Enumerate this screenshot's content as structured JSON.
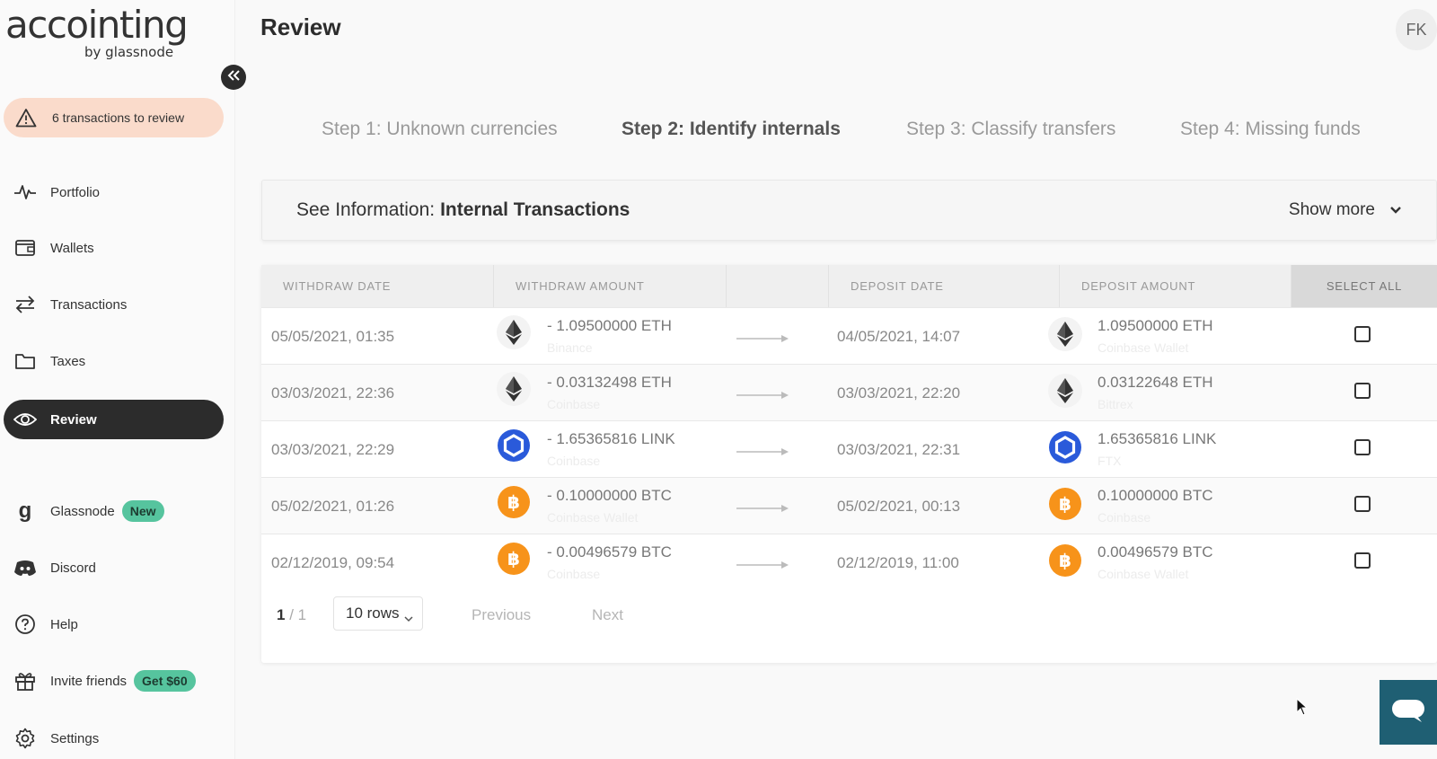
{
  "app": {
    "logo_text": "accointing",
    "logo_sub": "by glassnode",
    "user_initials": "FK"
  },
  "alert": {
    "label": "6 transactions to review",
    "icon": "warning-icon"
  },
  "sidebar": {
    "items": [
      {
        "label": "Portfolio",
        "icon": "pulse-icon"
      },
      {
        "label": "Wallets",
        "icon": "wallet-icon"
      },
      {
        "label": "Transactions",
        "icon": "swap-arrows-icon"
      },
      {
        "label": "Taxes",
        "icon": "folder-icon"
      },
      {
        "label": "Review",
        "icon": "eye-icon",
        "active": true
      },
      {
        "label": "Glassnode",
        "icon": "glassnode-g-icon",
        "badge": "New"
      },
      {
        "label": "Discord",
        "icon": "discord-icon"
      },
      {
        "label": "Help",
        "icon": "help-circle-icon"
      },
      {
        "label": "Invite friends",
        "icon": "gift-icon",
        "badge": "Get $60"
      },
      {
        "label": "Settings",
        "icon": "gear-icon"
      }
    ]
  },
  "header": {
    "title": "Review"
  },
  "steps": [
    {
      "label": "Step 1: Unknown currencies",
      "active": false
    },
    {
      "label": "Step 2: Identify internals",
      "active": true
    },
    {
      "label": "Step 3: Classify transfers",
      "active": false
    },
    {
      "label": "Step 4: Missing funds",
      "active": false
    }
  ],
  "info_bar": {
    "prefix": "See Information:",
    "title": "Internal Transactions",
    "show_more": "Show more"
  },
  "table": {
    "columns": [
      "WITHDRAW DATE",
      "WITHDRAW AMOUNT",
      "DEPOSIT DATE",
      "DEPOSIT AMOUNT",
      "SELECT ALL"
    ],
    "rows": [
      {
        "withdraw_date": "05/05/2021, 01:35",
        "coin": "ETH",
        "withdraw_amount": "- 1.09500000 ETH",
        "withdraw_exchange": "Binance",
        "deposit_date": "04/05/2021, 14:07",
        "deposit_amount": "1.09500000 ETH",
        "deposit_exchange": "Coinbase Wallet",
        "checked": false
      },
      {
        "withdraw_date": "03/03/2021, 22:36",
        "coin": "ETH",
        "withdraw_amount": "- 0.03132498 ETH",
        "withdraw_exchange": "Coinbase",
        "deposit_date": "03/03/2021, 22:20",
        "deposit_amount": "0.03122648 ETH",
        "deposit_exchange": "Bittrex",
        "checked": false
      },
      {
        "withdraw_date": "03/03/2021, 22:29",
        "coin": "LINK",
        "withdraw_amount": "- 1.65365816 LINK",
        "withdraw_exchange": "Coinbase",
        "deposit_date": "03/03/2021, 22:31",
        "deposit_amount": "1.65365816 LINK",
        "deposit_exchange": "FTX",
        "checked": false
      },
      {
        "withdraw_date": "05/02/2021, 01:26",
        "coin": "BTC",
        "withdraw_amount": "- 0.10000000 BTC",
        "withdraw_exchange": "Coinbase Wallet",
        "deposit_date": "05/02/2021, 00:13",
        "deposit_amount": "0.10000000 BTC",
        "deposit_exchange": "Coinbase",
        "checked": false
      },
      {
        "withdraw_date": "02/12/2019, 09:54",
        "coin": "BTC",
        "withdraw_amount": "- 0.00496579 BTC",
        "withdraw_exchange": "Coinbase",
        "deposit_date": "02/12/2019, 11:00",
        "deposit_amount": "0.00496579 BTC",
        "deposit_exchange": "Coinbase Wallet",
        "checked": false
      }
    ]
  },
  "pagination": {
    "current": "1",
    "total": "/ 1",
    "rows_per_page": "10 rows",
    "previous": "Previous",
    "next": "Next"
  },
  "colors": {
    "accent_dark": "#2c2c2c",
    "alert_bg": "#fadbcb",
    "badge_green": "#56c49e",
    "eth": "#333333",
    "link": "#2a5ada",
    "btc": "#f7931a",
    "chat_button": "#1f5f73"
  }
}
